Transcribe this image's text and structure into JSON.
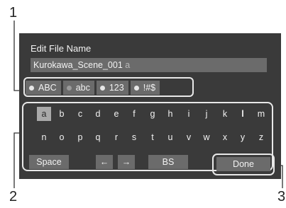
{
  "callouts": [
    "1",
    "2",
    "3"
  ],
  "dialog": {
    "title": "Edit File Name",
    "filename": "Kurokawa_Scene_001",
    "cursor_char": "a"
  },
  "modes": [
    {
      "label": "ABC",
      "active": true
    },
    {
      "label": "abc",
      "active": false
    },
    {
      "label": "123",
      "active": true
    },
    {
      "label": "!#$",
      "active": true
    }
  ],
  "keyboard": {
    "row1": [
      "a",
      "b",
      "c",
      "d",
      "e",
      "f",
      "g",
      "h",
      "i",
      "j",
      "k",
      "l",
      "m"
    ],
    "row2": [
      "n",
      "o",
      "p",
      "q",
      "r",
      "s",
      "t",
      "u",
      "v",
      "w",
      "x",
      "y",
      "z"
    ],
    "selected_key": "a",
    "space_label": "Space",
    "left_arrow": "←",
    "right_arrow": "→",
    "backspace_label": "BS",
    "done_label": "Done"
  },
  "colors": {
    "screen_bg": "#3a3a3a",
    "key_bg": "#6b6b6b",
    "highlight": "#a9a9a9",
    "outline": "#e8e8e8"
  }
}
